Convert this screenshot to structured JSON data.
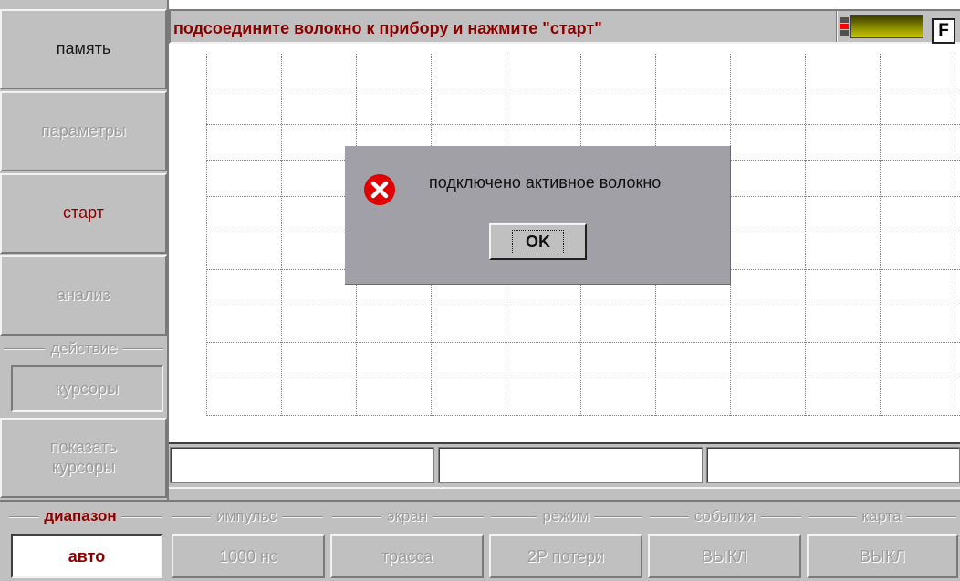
{
  "sidebar": {
    "memory": "память",
    "parameters": "параметры",
    "start": "старт",
    "analysis": "анализ",
    "action_group": "действие",
    "cursors": "курсоры",
    "show_cursors_line1": "показать",
    "show_cursors_line2": "курсоры"
  },
  "status": {
    "message": "подсоедините волокно к прибору и нажмите \"старт\"",
    "f_button": "F"
  },
  "dialog": {
    "message": "подключено активное волокно",
    "ok_label": "OK",
    "icon": "error-icon"
  },
  "bottom": {
    "range_label": "диапазон",
    "range_value": "авто",
    "pulse_label": "импульс",
    "pulse_value": "1000 нс",
    "screen_label": "экран",
    "screen_value": "трасса",
    "mode_label": "режим",
    "mode_value": "2P потери",
    "events_label": "события",
    "events_value": "ВЫКЛ",
    "map_label": "карта",
    "map_value": "ВЫКЛ"
  },
  "colors": {
    "accent_red": "#8a0000",
    "panel_gray": "#c0c0c0",
    "dialog_gray": "#a0a0a6"
  }
}
